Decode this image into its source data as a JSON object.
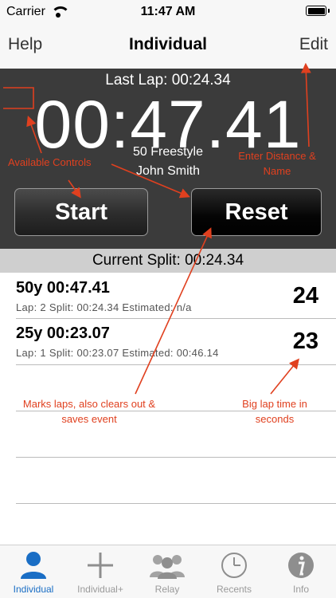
{
  "status_bar": {
    "carrier": "Carrier",
    "time": "11:47 AM"
  },
  "nav": {
    "left": "Help",
    "title": "Individual",
    "right": "Edit"
  },
  "timer": {
    "last_lap": "Last Lap: 00:24.34",
    "elapsed": "00:47.41",
    "event": "50 Freestyle",
    "swimmer": "John Smith",
    "start_label": "Start",
    "reset_label": "Reset"
  },
  "current_split": "Current Split: 00:24.34",
  "laps": [
    {
      "head": "50y 00:47.41",
      "detail": "Lap: 2  Split: 00:24.34  Estimated: n/a",
      "seconds": "24"
    },
    {
      "head": "25y 00:23.07",
      "detail": "Lap: 1  Split: 00:23.07  Estimated: 00:46.14",
      "seconds": "23"
    }
  ],
  "annotations": {
    "controls": "Available Controls",
    "distance": "Enter Distance & Name",
    "marks": "Marks laps, also clears out & saves event",
    "big_lap": "Big lap time in seconds"
  },
  "colors": {
    "annotation": "#e0401f",
    "active_tab": "#1a6ec5",
    "panel": "#3b3b3b"
  },
  "tabs": [
    {
      "label": "Individual",
      "icon": "person-icon",
      "active": true
    },
    {
      "label": "Individual+",
      "icon": "plus-icon",
      "active": false
    },
    {
      "label": "Relay",
      "icon": "group-icon",
      "active": false
    },
    {
      "label": "Recents",
      "icon": "clock-icon",
      "active": false
    },
    {
      "label": "Info",
      "icon": "info-icon",
      "active": false
    }
  ]
}
